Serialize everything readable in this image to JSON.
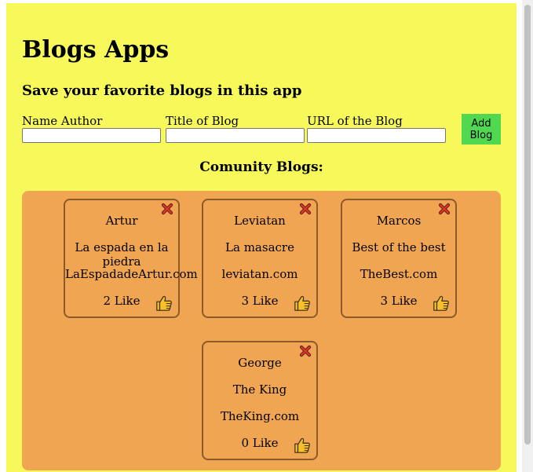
{
  "header": {
    "title": "Blogs Apps",
    "subtitle": "Save your favorite blogs in this app"
  },
  "form": {
    "author_label": "Name Author",
    "author_value": "",
    "title_label": "Title of Blog",
    "title_value": "",
    "url_label": "URL of the Blog",
    "url_value": "",
    "add_button_label": "Add Blog"
  },
  "community": {
    "heading": "Comunity Blogs:",
    "blogs": [
      {
        "author": "Artur",
        "title": "La espada en la piedra",
        "url": "LaEspadadeArtur.com",
        "likes": "2 Like"
      },
      {
        "author": "Leviatan",
        "title": "La masacre",
        "url": "leviatan.com",
        "likes": "3 Like"
      },
      {
        "author": "Marcos",
        "title": "Best of the best",
        "url": "TheBest.com",
        "likes": "3 Like"
      },
      {
        "author": "George",
        "title": "The King",
        "url": "TheKing.com",
        "likes": "0 Like"
      }
    ]
  },
  "icons": {
    "delete": "close-x-icon",
    "like": "thumbs-up-icon"
  },
  "colors": {
    "page_background": "#f7f95a",
    "container_background": "#f0a552",
    "add_button": "#50d950",
    "delete_icon": "#d9342b",
    "like_icon": "#f7c02b"
  }
}
